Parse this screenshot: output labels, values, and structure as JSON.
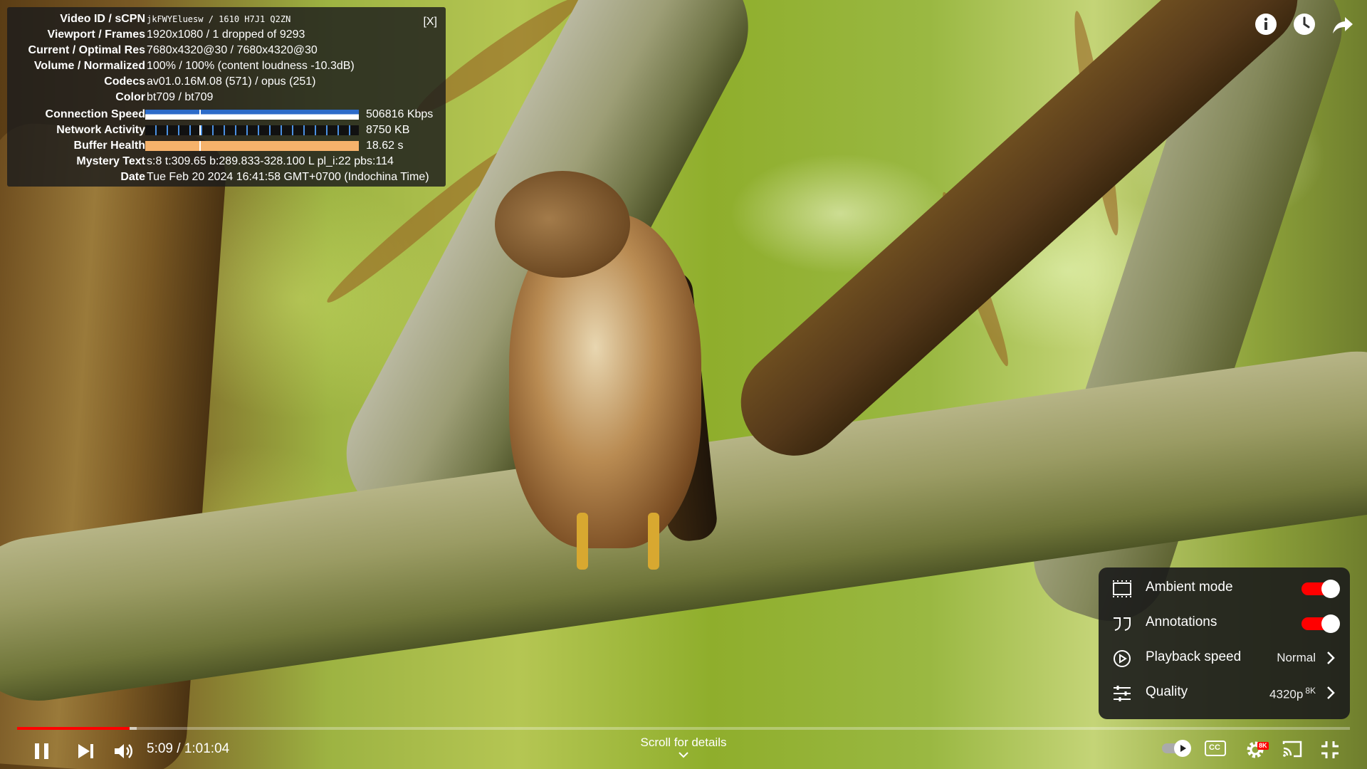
{
  "stats": {
    "rows": [
      {
        "label": "Video ID / sCPN",
        "value": "jkFWYEluesw / 1610 H7J1 Q2ZN"
      },
      {
        "label": "Viewport / Frames",
        "value": "1920x1080 / 1 dropped of 9293"
      },
      {
        "label": "Current / Optimal Res",
        "value": "7680x4320@30 / 7680x4320@30"
      },
      {
        "label": "Volume / Normalized",
        "value": "100% / 100% (content loudness -10.3dB)"
      },
      {
        "label": "Codecs",
        "value": "av01.0.16M.08 (571) / opus (251)"
      },
      {
        "label": "Color",
        "value": "bt709 / bt709"
      },
      {
        "label": "Connection Speed",
        "value": "506816 Kbps"
      },
      {
        "label": "Network Activity",
        "value": "8750 KB"
      },
      {
        "label": "Buffer Health",
        "value": "18.62 s"
      },
      {
        "label": "Mystery Text",
        "value": "s:8 t:309.65 b:289.833-328.100 L pl_i:22 pbs:114"
      },
      {
        "label": "Date",
        "value": "Tue Feb 20 2024 16:41:58 GMT+0700 (Indochina Time)"
      }
    ],
    "close": "[X]"
  },
  "settings_menu": {
    "items": [
      {
        "label": "Ambient mode",
        "toggle": true
      },
      {
        "label": "Annotations",
        "toggle": true
      },
      {
        "label": "Playback speed",
        "value": "Normal"
      },
      {
        "label": "Quality",
        "value": "4320p",
        "badge": "8K"
      }
    ]
  },
  "player": {
    "current_time": "5:09",
    "duration": "1:01:04",
    "time_display": "5:09 / 1:01:04",
    "progress_played": 0.0844,
    "progress_loaded": 0.0895,
    "scroll_hint": "Scroll for details",
    "settings_badge": "8K",
    "cc_label": "CC"
  },
  "icons": {
    "top_right": [
      "info-icon",
      "watch-later-icon",
      "share-icon"
    ],
    "controls": [
      "pause-icon",
      "next-icon",
      "volume-icon",
      "autoplay-toggle",
      "cc-icon",
      "settings-gear-icon",
      "cast-icon",
      "exit-fullscreen-icon"
    ]
  },
  "colors": {
    "accent_red": "#ff0000",
    "panel_bg": "#1c1c1c",
    "buffer_orange": "#f6b26b",
    "connection_blue": "#2c6bc9"
  }
}
